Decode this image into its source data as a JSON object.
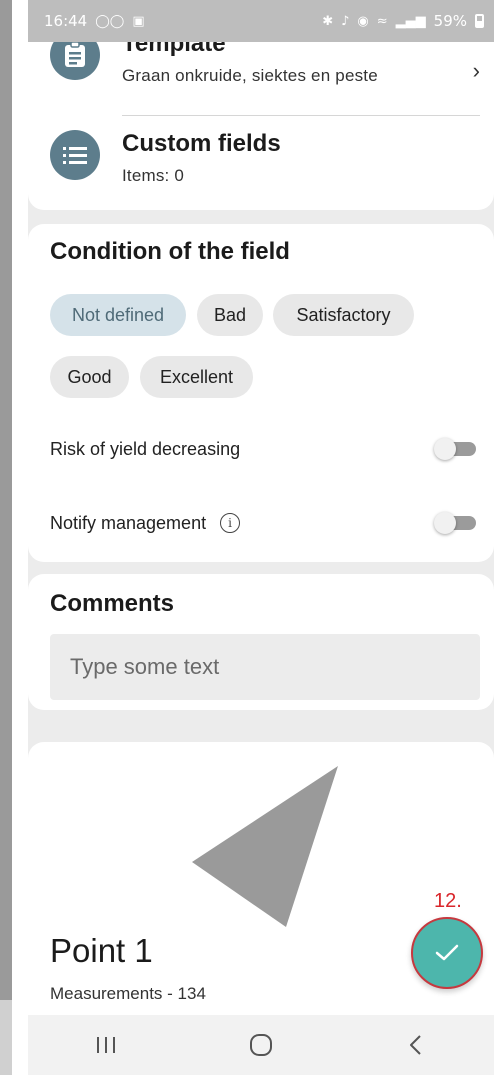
{
  "status_bar": {
    "time": "16:44",
    "battery": "59%"
  },
  "template": {
    "title": "Template",
    "subtitle": "Graan onkruide, siektes en peste",
    "icon": "clipboard-icon"
  },
  "custom_fields": {
    "title": "Custom fields",
    "subtitle": "Items: 0",
    "icon": "list-icon"
  },
  "condition": {
    "title": "Condition of the field",
    "chips": [
      "Not defined",
      "Bad",
      "Satisfactory",
      "Good",
      "Excellent"
    ],
    "selected": "Not defined",
    "risk_label": "Risk of yield decreasing",
    "risk_on": false,
    "notify_label": "Notify management",
    "notify_on": false
  },
  "comments": {
    "title": "Comments",
    "placeholder": "Type some text"
  },
  "point": {
    "title": "Point 1",
    "subtitle": "Measurements - 134"
  },
  "fab": {
    "badge": "12.",
    "icon": "check-icon"
  },
  "colors": {
    "accent": "#4db6ac",
    "avatar": "#5d7d8c",
    "selected_chip": "#d5e2e9",
    "badge": "#d9262b"
  }
}
